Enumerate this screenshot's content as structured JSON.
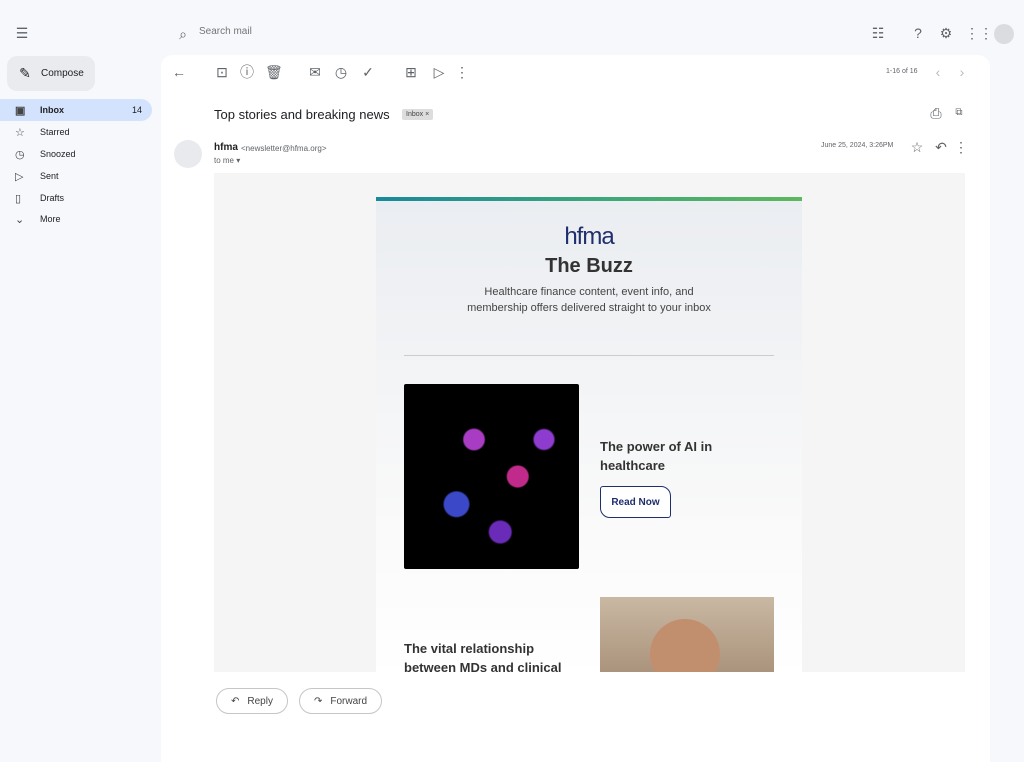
{
  "search": {
    "placeholder": "Search mail"
  },
  "compose": "Compose",
  "sidebar": {
    "items": [
      {
        "label": "Inbox",
        "count": "14",
        "icon": "inbox-icon"
      },
      {
        "label": "Starred",
        "icon": "star-icon"
      },
      {
        "label": "Snoozed",
        "icon": "clock-icon"
      },
      {
        "label": "Sent",
        "icon": "send-icon"
      },
      {
        "label": "Drafts",
        "icon": "draft-icon"
      },
      {
        "label": "More",
        "icon": "chevron-down-icon"
      }
    ]
  },
  "toolbar": {
    "pagination": "1-16 of 16"
  },
  "email": {
    "subject": "Top stories and breaking news",
    "label": "Inbox",
    "sender_name": "hfma",
    "sender_email": "<newsletter@hfma.org>",
    "to": "to me",
    "date": "June 25, 2024, 3:26PM"
  },
  "newsletter": {
    "logo": "hfma",
    "title": "The Buzz",
    "subtitle_line1": "Healthcare finance content, event info, and",
    "subtitle_line2": "membership offers delivered straight to your inbox",
    "article1": {
      "title": "The power of AI in healthcare",
      "button": "Read Now"
    },
    "article2": {
      "title": "The vital relationship between MDs and clinical"
    }
  },
  "actions": {
    "reply": "Reply",
    "forward": "Forward"
  }
}
